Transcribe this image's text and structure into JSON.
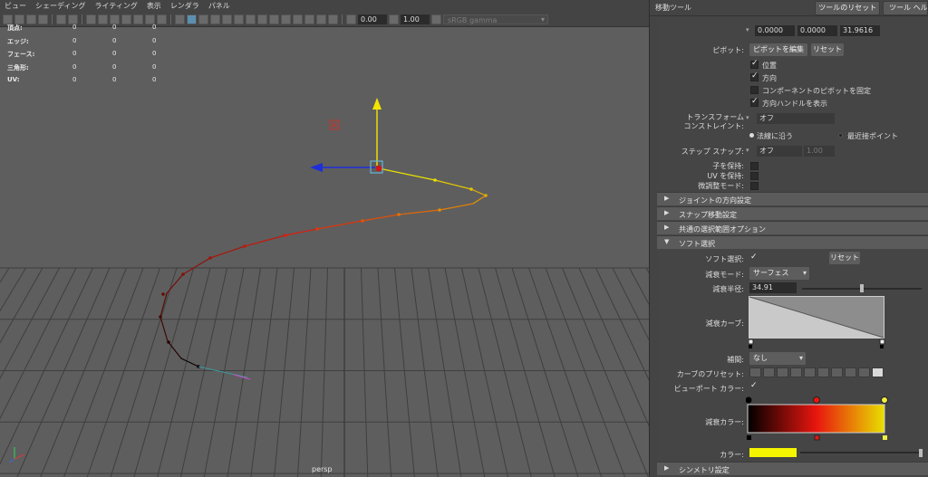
{
  "menu": [
    "ビュー",
    "シェーディング",
    "ライティング",
    "表示",
    "レンダラ",
    "パネル"
  ],
  "toolbar": {
    "value1": "0.00",
    "value2": "1.00",
    "colorspace": "sRGB gamma"
  },
  "hud": [
    {
      "label": "頂点:",
      "v1": "0",
      "v2": "0",
      "v3": "0"
    },
    {
      "label": "エッジ:",
      "v1": "0",
      "v2": "0",
      "v3": "0"
    },
    {
      "label": "フェース:",
      "v1": "0",
      "v2": "0",
      "v3": "0"
    },
    {
      "label": "三角形:",
      "v1": "0",
      "v2": "0",
      "v3": "0"
    },
    {
      "label": "UV:",
      "v1": "0",
      "v2": "0",
      "v3": "0"
    }
  ],
  "viewport": {
    "camera": "persp"
  },
  "panel": {
    "title": "移動ツール",
    "reset_tool": "ツールのリセット",
    "tool_help": "ツール ヘルプ",
    "position": [
      "0.0000",
      "0.0000",
      "31.9616"
    ],
    "pivot_label": "ピボット:",
    "pivot_edit": "ピボットを編集",
    "pivot_reset": "リセット",
    "checks": [
      {
        "label": "位置",
        "checked": true
      },
      {
        "label": "方向",
        "checked": true
      },
      {
        "label": "コンポーネントのピボットを固定",
        "checked": false
      },
      {
        "label": "方向ハンドルを表示",
        "checked": true
      }
    ],
    "constraint_label1": "トランスフォーム",
    "constraint_label2": "コンストレイント:",
    "constraint_value": "オフ",
    "radio_normal": "法線に沿う",
    "radio_nearest": "最近接ポイント",
    "step_snap_label": "ステップ スナップ:",
    "step_snap_value": "オフ",
    "step_snap_num": "1.00",
    "keep_children": "子を保持:",
    "keep_uv": "UV を保持:",
    "tweak_mode": "微調整モード:",
    "sections": [
      "ジョイントの方向設定",
      "スナップ移動設定",
      "共通の選択範囲オプション",
      "ソフト選択"
    ],
    "soft_select_label": "ソフト選択:",
    "soft_reset": "リセット",
    "falloff_mode_label": "減衰モード:",
    "falloff_mode_value": "サーフェス",
    "falloff_radius_label": "減衰半径:",
    "falloff_radius_value": "34.91",
    "falloff_radius_fraction": 0.5,
    "falloff_curve_label": "減衰カーブ:",
    "interp_label": "補間:",
    "interp_value": "なし",
    "curve_presets_label": "カーブのプリセット:",
    "viewport_color_label": "ビューポート カラー:",
    "falloff_color_label": "減衰カラー:",
    "color_label": "カラー:",
    "color_value": "#f5f500",
    "symmetry": "シンメトリ設定"
  },
  "colors": {
    "viewport_bg": "#5e5e5e",
    "panel_bg": "#444444",
    "axis_y": "#f2e600",
    "axis_x": "#1e2fd8",
    "gradient_start": "#000000",
    "gradient_mid": "#e8150e",
    "gradient_end": "#e8e000"
  }
}
